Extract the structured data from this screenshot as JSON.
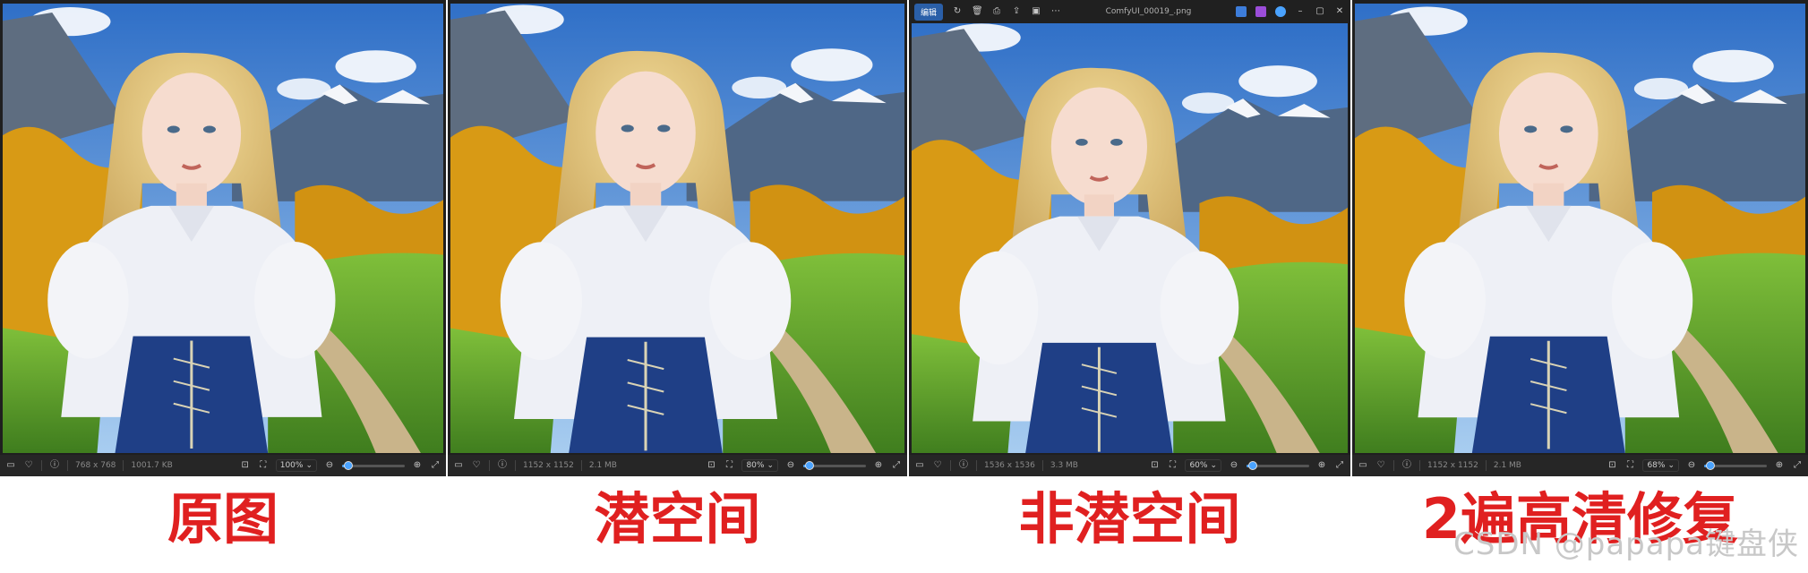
{
  "panels": [
    {
      "id": "p1",
      "dims": "768 x 768",
      "size": "1001.7 KB",
      "zoom": "100%",
      "zoom_fraction": 0.1
    },
    {
      "id": "p2",
      "dims": "1152 x 1152",
      "size": "2.1 MB",
      "zoom": "80%",
      "zoom_fraction": 0.1
    },
    {
      "id": "p3",
      "dims": "1536 x 1536",
      "size": "3.3 MB",
      "zoom": "60%",
      "zoom_fraction": 0.1
    },
    {
      "id": "p4",
      "dims": "1152 x 1152",
      "size": "2.1 MB",
      "zoom": "68%",
      "zoom_fraction": 0.1
    }
  ],
  "titlebar": {
    "edit_label": "编辑",
    "filename": "ComfyUI_00019_.png"
  },
  "captions": [
    "原图",
    "潜空间",
    "非潜空间",
    "2遍高清修复"
  ],
  "watermark": "CSDN @papapa键盘侠",
  "colors": {
    "caption": "#e02020",
    "accent": "#4aa3ff"
  },
  "icons": [
    "image-icon",
    "heart-icon",
    "info-icon",
    "crop-icon",
    "fit-icon",
    "zoom-out-icon",
    "zoom-in-icon",
    "expand-icon"
  ]
}
